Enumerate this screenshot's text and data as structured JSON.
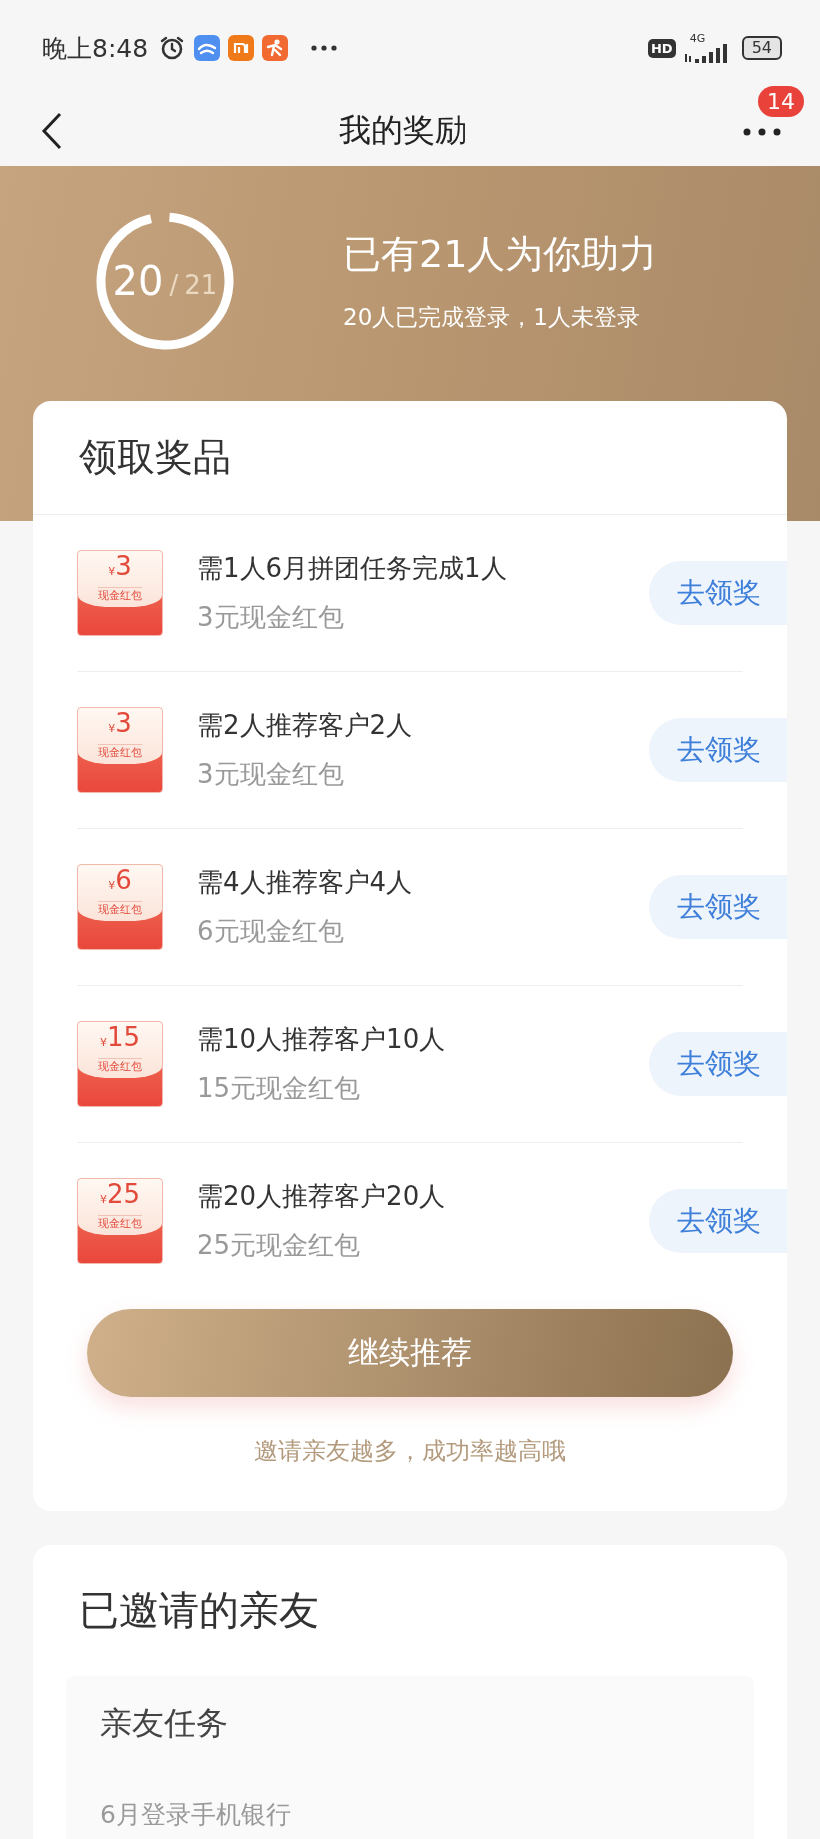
{
  "status_bar": {
    "time": "晚上8:48",
    "hd": "HD",
    "network": "4G",
    "battery": "54"
  },
  "nav": {
    "title": "我的奖励",
    "badge": "14"
  },
  "summary": {
    "done": "20",
    "separator": "/",
    "total": "21",
    "level": 0.952,
    "headline": "已有21人为你助力",
    "detail": "20人已完成登录，1人未登录"
  },
  "rewards": {
    "title": "领取奖品",
    "items": [
      {
        "currency": "¥",
        "amount": "3",
        "envelope_label": "现金红包",
        "requirement": "需1人6月拼团任务完成1人",
        "prize": "3元现金红包",
        "action": "去领奖"
      },
      {
        "currency": "¥",
        "amount": "3",
        "envelope_label": "现金红包",
        "requirement": "需2人推荐客户2人",
        "prize": "3元现金红包",
        "action": "去领奖"
      },
      {
        "currency": "¥",
        "amount": "6",
        "envelope_label": "现金红包",
        "requirement": "需4人推荐客户4人",
        "prize": "6元现金红包",
        "action": "去领奖"
      },
      {
        "currency": "¥",
        "amount": "15",
        "envelope_label": "现金红包",
        "requirement": "需10人推荐客户10人",
        "prize": "15元现金红包",
        "action": "去领奖"
      },
      {
        "currency": "¥",
        "amount": "25",
        "envelope_label": "现金红包",
        "requirement": "需20人推荐客户20人",
        "prize": "25元现金红包",
        "action": "去领奖"
      }
    ],
    "button": "继续推荐",
    "hint": "邀请亲友越多，成功率越高哦"
  },
  "invited": {
    "title": "已邀请的亲友",
    "panel_title": "亲友任务",
    "task": "6月登录手机银行"
  }
}
